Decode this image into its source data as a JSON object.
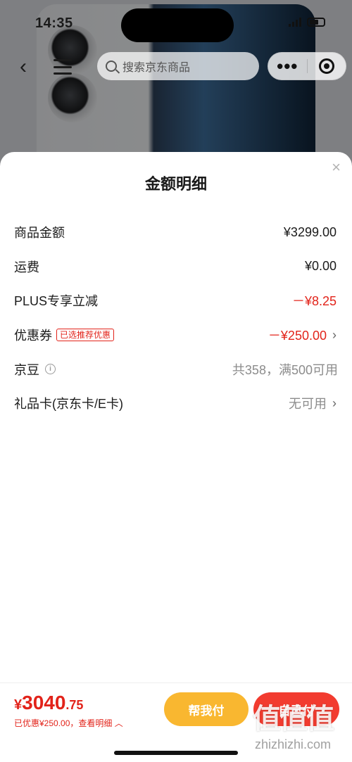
{
  "status_bar": {
    "time": "14:35"
  },
  "nav": {
    "search_placeholder": "搜索京东商品",
    "more_icon": "more-dots-icon",
    "close_icon": "target-close-icon"
  },
  "sheet": {
    "title": "金额明细",
    "close_symbol": "×",
    "rows": [
      {
        "label": "商品金额",
        "value": "¥3299.00"
      },
      {
        "label": "运费",
        "value": "¥0.00"
      },
      {
        "label": "PLUS专享立减",
        "value": "－¥8.25"
      },
      {
        "label": "优惠券",
        "tag": "已选推荐优惠",
        "value": "－¥250.00"
      },
      {
        "label": "京豆",
        "value": "共358，满500可用"
      },
      {
        "label": "礼品卡(京东卡/E卡)",
        "value": "无可用"
      }
    ]
  },
  "footer": {
    "currency": "¥",
    "price_int": "3040",
    "price_dec": ".75",
    "discount_text": "已优惠¥250.00，查看明细",
    "help_pay_label": "帮我付",
    "self_pay_label": "自己付"
  },
  "watermark": {
    "logo": "值值值",
    "url": "zhizhizhi.com"
  },
  "colors": {
    "accent_red": "#e2231a",
    "help_yellow": "#f9b730",
    "pay_red": "#f23b2f"
  }
}
